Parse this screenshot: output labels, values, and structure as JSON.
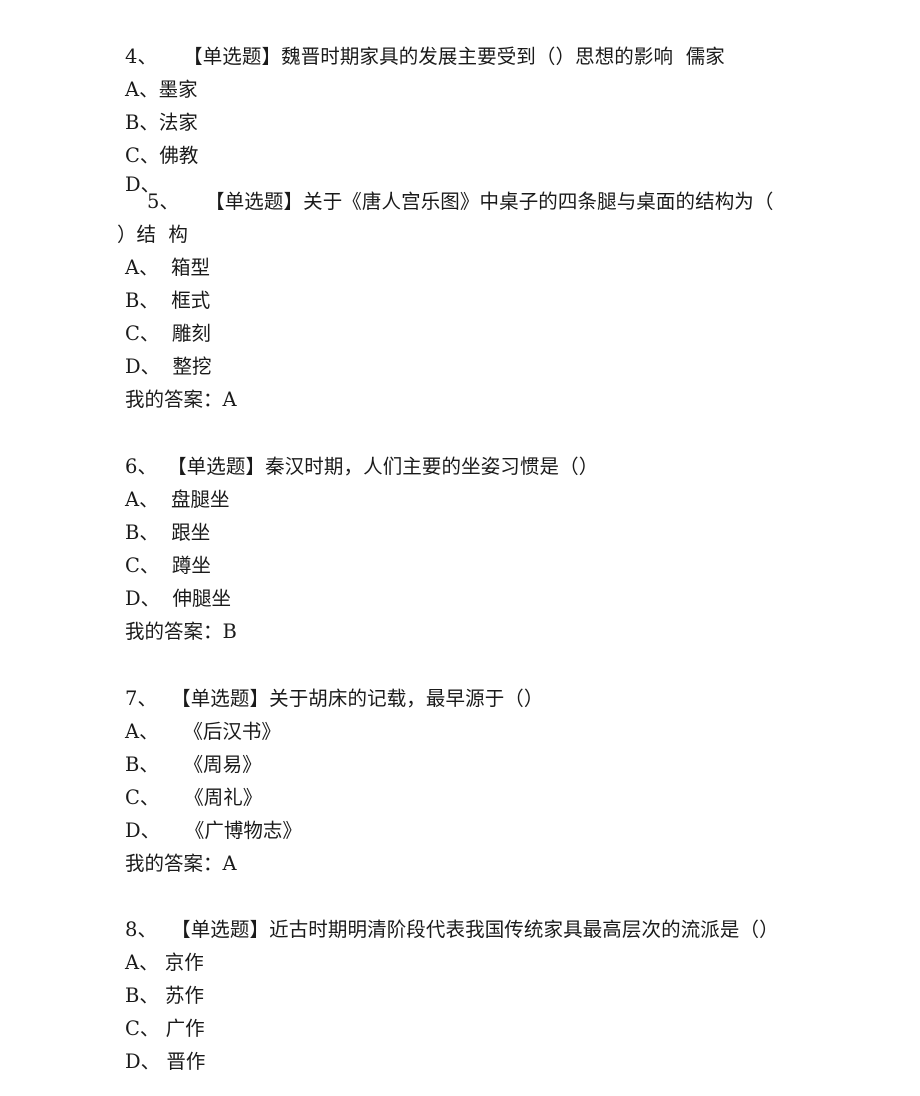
{
  "document": {
    "type": "exam-answer-sheet",
    "text_color": "#1a1a1a",
    "background_color": "#ffffff",
    "answer_label": "我的答案：",
    "question_type_tag": "【单选题】"
  },
  "questions": [
    {
      "number": "4、",
      "prompt": "【单选题】魏晋时期家具的发展主要受到（）思想的影响  儒家",
      "options": [
        {
          "letter": "A、",
          "text": "墨家"
        },
        {
          "letter": "B、",
          "text": "法家"
        },
        {
          "letter": "C、",
          "text": "佛教"
        },
        {
          "letter": "D、",
          "text": ""
        }
      ],
      "my_answer_line": ""
    },
    {
      "number": "5、",
      "prompt": "【单选题】关于《唐人宫乐图》中桌子的四条腿与桌面的结构为（",
      "prompt_cont": "）结  构",
      "options": [
        {
          "letter": "A、",
          "text": "  箱型"
        },
        {
          "letter": "B、",
          "text": "  框式"
        },
        {
          "letter": "C、",
          "text": "  雕刻"
        },
        {
          "letter": "D、",
          "text": "  整挖"
        }
      ],
      "my_answer_line": "我的答案：A"
    },
    {
      "number": "6、",
      "prompt": "【单选题】秦汉时期，人们主要的坐姿习惯是（）",
      "options": [
        {
          "letter": "A、",
          "text": "  盘腿坐"
        },
        {
          "letter": "B、",
          "text": "  跟坐"
        },
        {
          "letter": "C、",
          "text": "  蹲坐"
        },
        {
          "letter": "D、",
          "text": "  伸腿坐"
        }
      ],
      "my_answer_line": "我的答案：B"
    },
    {
      "number": "7、",
      "prompt": "【单选题】关于胡床的记载，最早源于（）",
      "options": [
        {
          "letter": "A、",
          "text": "    《后汉书》"
        },
        {
          "letter": "B、",
          "text": "    《周易》"
        },
        {
          "letter": "C、",
          "text": "    《周礼》"
        },
        {
          "letter": "D、",
          "text": "    《广博物志》"
        }
      ],
      "my_answer_line": "我的答案：A"
    },
    {
      "number": "8、",
      "prompt": "【单选题】近古时期明清阶段代表我国传统家具最高层次的流派是（）",
      "options": [
        {
          "letter": "A、",
          "text": " 京作"
        },
        {
          "letter": "B、",
          "text": " 苏作"
        },
        {
          "letter": "C、",
          "text": " 广作"
        },
        {
          "letter": "D、",
          "text": " 晋作"
        }
      ],
      "my_answer_line": ""
    }
  ]
}
